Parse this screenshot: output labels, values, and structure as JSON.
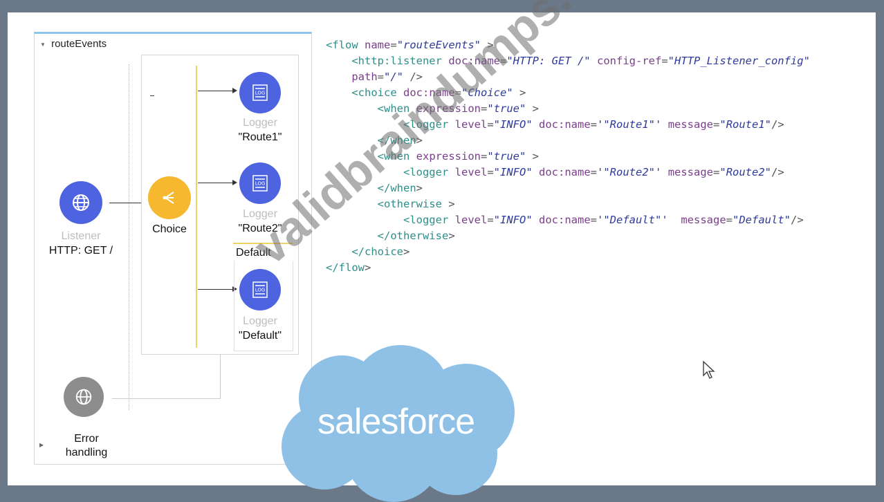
{
  "canvas": {
    "flow_name": "routeEvents",
    "listener": {
      "type": "Listener",
      "name": "HTTP: GET /"
    },
    "choice": {
      "name": "Choice"
    },
    "routes": [
      {
        "type": "Logger",
        "name": "\"Route1\""
      },
      {
        "type": "Logger",
        "name": "\"Route2\""
      },
      {
        "type": "Logger",
        "name": "\"Default\""
      }
    ],
    "default_label": "Default",
    "error_handling": {
      "line1": "Error",
      "line2": "handling"
    }
  },
  "code": {
    "lines": [
      "<flow name=\"routeEvents\" >",
      "    <http:listener doc:name=\"HTTP: GET /\" config-ref=\"HTTP_Listener_config\"",
      "    path=\"/\" />",
      "    <choice doc:name=\"Choice\" >",
      "        <when expression=\"true\" >",
      "            <logger level=\"INFO\" doc:name='\"Route1\"' message=\"Route1\"/>",
      "        </when>",
      "        <when expression=\"true\" >",
      "            <logger level=\"INFO\" doc:name='\"Route2\"' message=\"Route2\"/>",
      "        </when>",
      "        <otherwise >",
      "            <logger level=\"INFO\" doc:name='\"Default\"'  message=\"Default\"/>",
      "        </otherwise>",
      "    </choice>",
      "</flow>"
    ]
  },
  "watermark": "validbraindumps.com",
  "logo": {
    "text": "salesforce",
    "color": "#8fc0e6"
  },
  "colors": {
    "mule_blue": "#4d63e0",
    "choice_yellow": "#f5b82e",
    "error_gray": "#8d8d8d",
    "frame": "#6b7888"
  },
  "icons": [
    "collapse-caret-icon",
    "globe-icon",
    "choice-split-icon",
    "log-icon",
    "mouse-pointer-icon"
  ]
}
